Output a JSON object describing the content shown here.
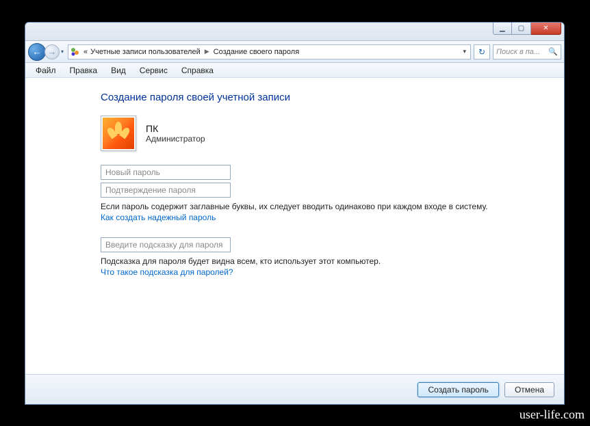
{
  "titlebar": {
    "min_glyph": "▁",
    "max_glyph": "▢",
    "close_glyph": "✕"
  },
  "nav": {
    "back_glyph": "←",
    "fwd_glyph": "→",
    "dd_glyph": "▾",
    "refresh_glyph": "↻",
    "search_glyph": "🔍",
    "addr_prefix": "«",
    "addr1": "Учетные записи пользователей",
    "addr2": "Создание своего пароля",
    "search_placeholder": "Поиск в па..."
  },
  "menu": [
    "Файл",
    "Правка",
    "Вид",
    "Сервис",
    "Справка"
  ],
  "page": {
    "title": "Создание пароля своей учетной записи",
    "user_name": "ПК",
    "user_role": "Администратор",
    "new_pw_placeholder": "Новый пароль",
    "confirm_pw_placeholder": "Подтверждение пароля",
    "caps_info": "Если пароль содержит заглавные буквы, их следует вводить одинаково при каждом входе в систему.",
    "strong_link": "Как создать надежный пароль",
    "hint_placeholder": "Введите подсказку для пароля",
    "hint_info": "Подсказка для пароля будет видна всем, кто использует этот компьютер.",
    "hint_link": "Что такое подсказка для паролей?"
  },
  "footer": {
    "create": "Создать пароль",
    "cancel": "Отмена"
  },
  "watermark": "user-life.com"
}
